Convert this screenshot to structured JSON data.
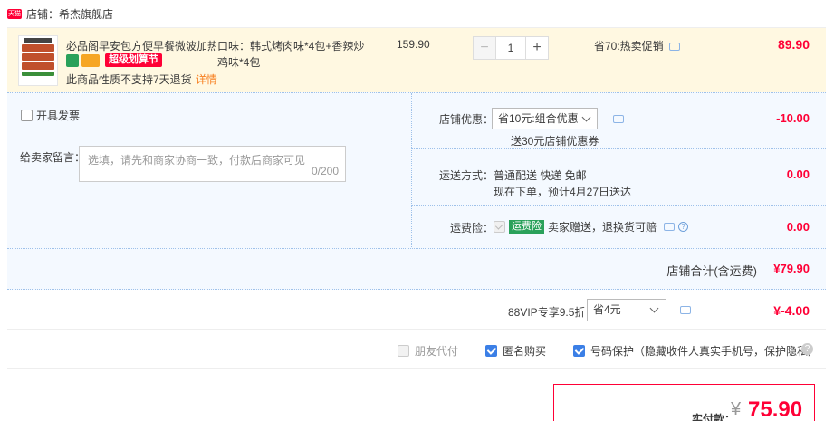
{
  "shop": {
    "badge": "天猫",
    "label": "店铺：希杰旗舰店"
  },
  "product": {
    "title": "必品阁早安包方便早餐微波加热...",
    "promo_tag": "超级划算节",
    "note": "此商品性质不支持7天退货",
    "detail_link": "详情",
    "spec": "口味：韩式烤肉味*4包+香辣炒鸡味*4包",
    "price": "159.90",
    "qty": "1",
    "qty_minus": "−",
    "qty_plus": "+",
    "discount": "省70:热卖促销",
    "subtotal": "89.90"
  },
  "options": {
    "invoice_label": "开具发票",
    "message_label": "给卖家留言：",
    "message_placeholder": "选填，请先和商家协商一致，付款后商家可见",
    "message_count": "0/200",
    "coupon_label": "店铺优惠：",
    "coupon_value": "省10元:组合优惠",
    "coupon_note": "送30元店铺优惠券",
    "coupon_amount": "-10.00",
    "shipping_label": "运送方式：",
    "shipping_line1": "普通配送 快递 免邮",
    "shipping_line2": "现在下单，预计4月27日送达",
    "shipping_amount": "0.00",
    "insurance_label": "运费险：",
    "insurance_tag": "运费险",
    "insurance_text": "卖家赠送，退换货可赔",
    "insurance_amount": "0.00"
  },
  "shop_total": {
    "label": "店铺合计(含运费)",
    "value": "¥79.90"
  },
  "vip": {
    "label": "88VIP专享9.5折",
    "select_value": "省4元",
    "amount": "¥-4.00"
  },
  "checks": {
    "friend_pay": "朋友代付",
    "anonymous": "匿名购买",
    "number_protect": "号码保护（隐藏收件人真实手机号，保护隐私）",
    "help": "?"
  },
  "payment": {
    "label": "实付款：",
    "symbol": "¥",
    "value": "75.90"
  },
  "colors": {
    "accent": "#ff0036",
    "highlight_bg": "#fff8e1",
    "option_bg": "#f4f9ff",
    "check_blue": "#3b7fe6"
  }
}
